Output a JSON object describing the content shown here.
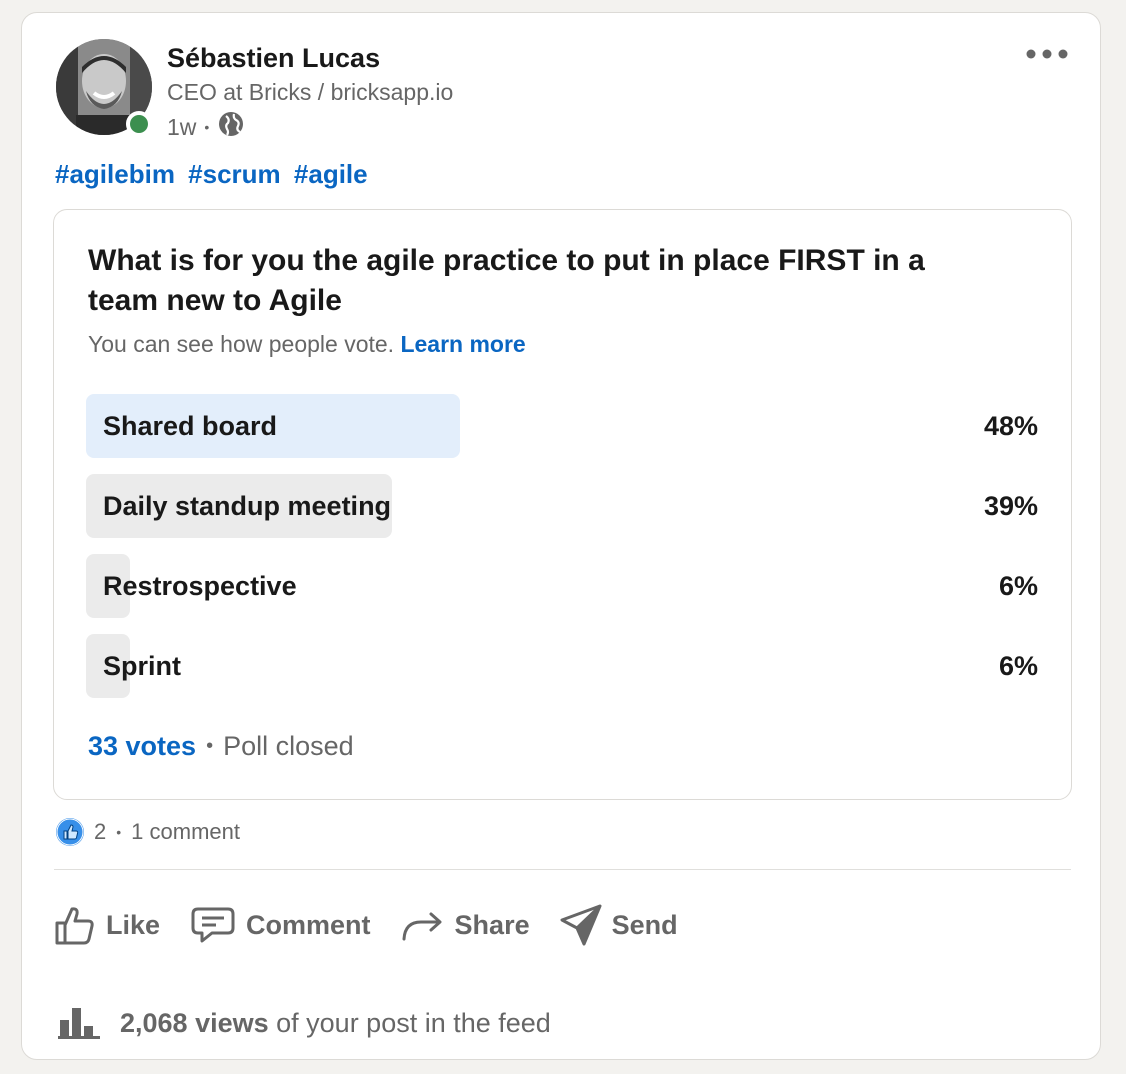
{
  "post": {
    "author": {
      "name": "Sébastien Lucas",
      "headline": "CEO at Bricks / bricksapp.io",
      "time": "1w",
      "separator": "•",
      "visibility_icon": "globe-icon",
      "presence": "online"
    },
    "hashtags": [
      "#agilebim",
      "#scrum",
      "#agile"
    ],
    "poll": {
      "question": "What is for you the agile practice to put in place FIRST in a team new to Agile",
      "note": "You can see how people vote.",
      "learn_more": "Learn more",
      "options": [
        {
          "label": "Shared board",
          "percent": "48%",
          "fraction": 0.48,
          "winner": true
        },
        {
          "label": "Daily standup meeting",
          "percent": "39%",
          "fraction": 0.39,
          "winner": false
        },
        {
          "label": "Restrospective",
          "percent": "6%",
          "fraction": 0.06,
          "winner": false
        },
        {
          "label": "Sprint",
          "percent": "6%",
          "fraction": 0.06,
          "winner": false
        }
      ],
      "votes": "33 votes",
      "separator": "•",
      "status": "Poll closed"
    },
    "social": {
      "reactions": "2",
      "separator": "•",
      "comments": "1 comment"
    },
    "actions": {
      "like": "Like",
      "comment": "Comment",
      "share": "Share",
      "send": "Send"
    },
    "views": {
      "count": "2,068 views",
      "suffix": "of your post in the feed"
    }
  },
  "colors": {
    "accent": "#0a66c2",
    "winner_bar": "#e3eefb",
    "bar": "#ebebeb",
    "presence": "#3c8f4f",
    "like_badge": "#378fe9"
  }
}
